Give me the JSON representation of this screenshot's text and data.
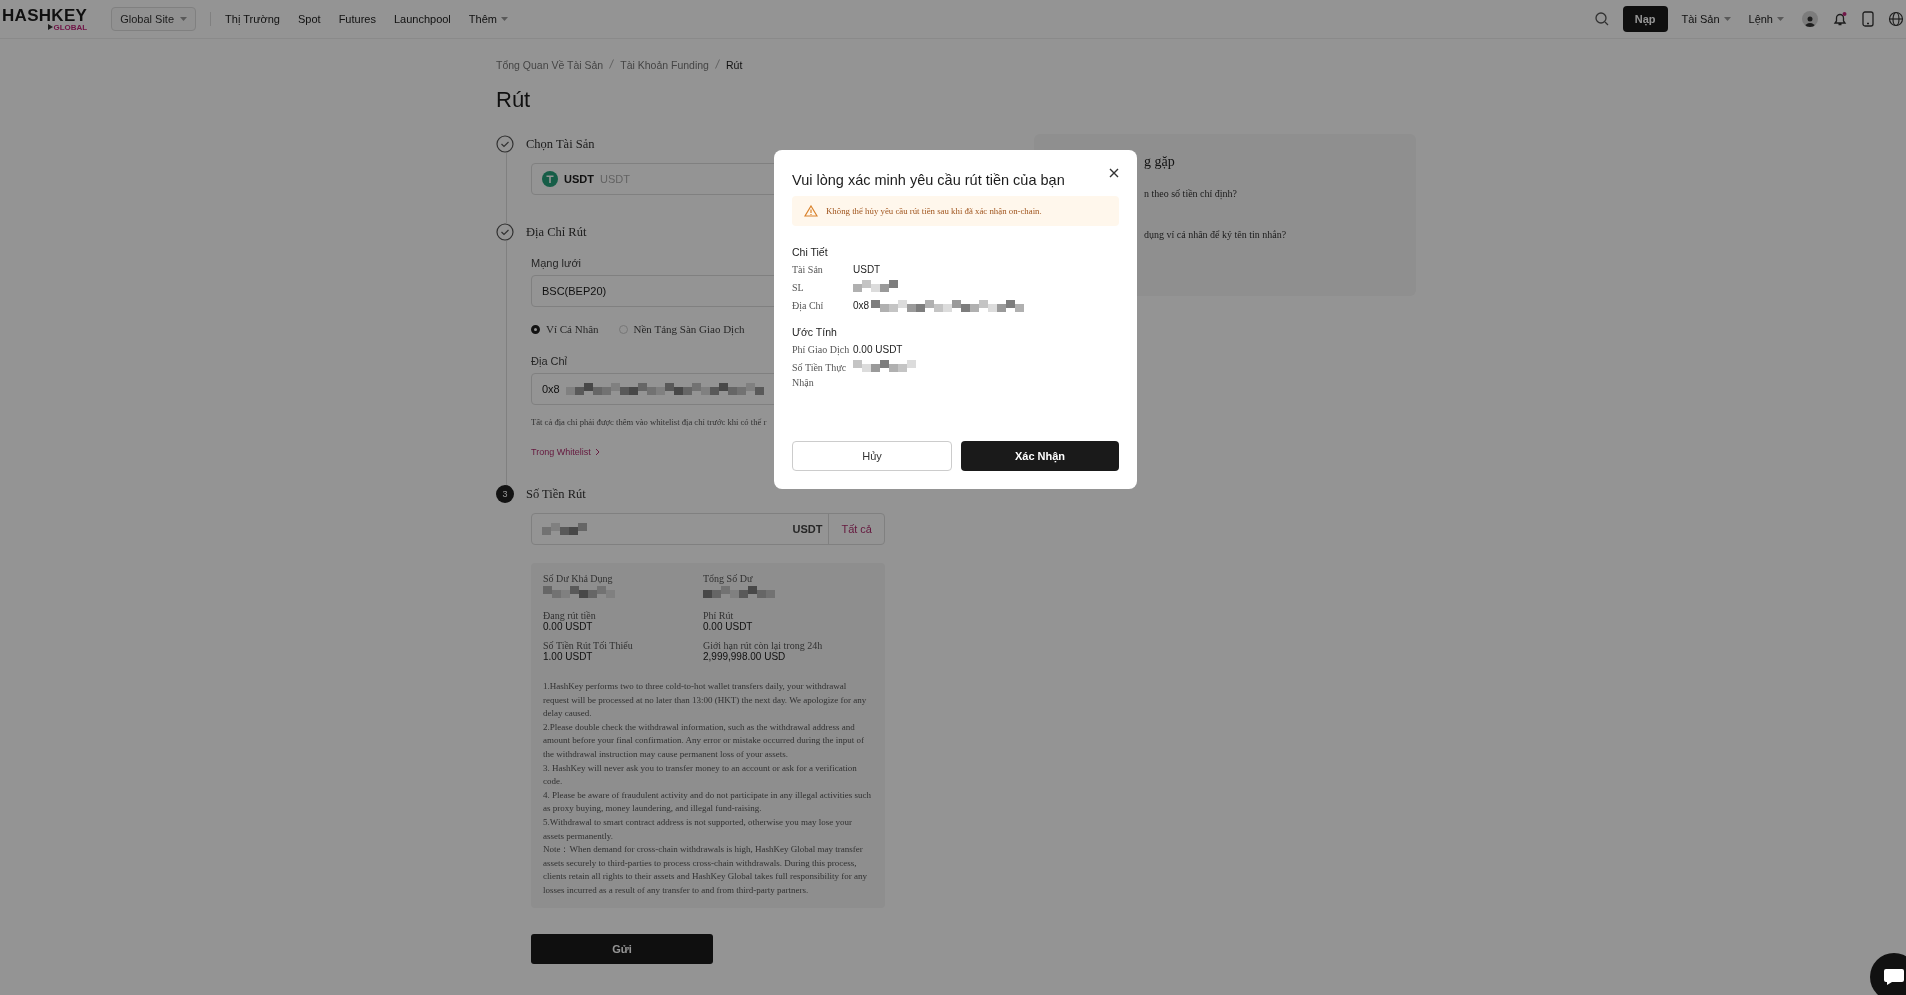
{
  "nav": {
    "logo": "HASHKEY",
    "logo_sub": "GLOBAL",
    "site_select": "Global Site",
    "menu": [
      {
        "label": "Thị Trường",
        "dropdown": false
      },
      {
        "label": "Spot",
        "dropdown": false
      },
      {
        "label": "Futures",
        "dropdown": false
      },
      {
        "label": "Launchpool",
        "dropdown": false
      },
      {
        "label": "Thêm",
        "dropdown": true
      }
    ],
    "deposit_button": "Nạp",
    "right_menu": [
      "Tài Sản",
      "Lệnh"
    ],
    "notifications_unread": true
  },
  "breadcrumb": [
    "Tổng Quan Về Tài Sản",
    "Tài Khoản Funding",
    "Rút"
  ],
  "title": "Rút",
  "asset_step": {
    "label": "Chọn Tài Sản",
    "done": true,
    "asset_symbol": "USDT",
    "asset_name": "USDT"
  },
  "address_step": {
    "label": "Địa Chỉ Rút",
    "done": true,
    "network_label": "Mạng lưới",
    "network": "BSC(BEP20)",
    "wallet_types": [
      {
        "label": "Ví Cá Nhân",
        "selected": true
      },
      {
        "label": "Nền Tảng Sàn Giao Dịch",
        "selected": false
      }
    ],
    "address_label": "Địa Chỉ",
    "address_prefix": "0x8",
    "hint": "Tất cả địa chỉ phải được thêm vào whitelist địa chỉ trước khi có thể r",
    "whitelist_link": "Trong Whitelist"
  },
  "amount_step": {
    "number": "3",
    "label": "Số Tiền Rút",
    "done": false,
    "unit": "USDT",
    "all_button": "Tất cả",
    "stats": [
      {
        "label": "Số Dư Khả Dụng",
        "masked": true
      },
      {
        "label": "Tổng Số Dư",
        "masked": true
      },
      {
        "label": "Đang rút tiền",
        "value": "0.00 USDT",
        "masked": false
      },
      {
        "label": "Phí Rút",
        "value": "0.00 USDT",
        "masked": false
      },
      {
        "label": "Số Tiền Rút Tối Thiểu",
        "value": "1.00 USDT",
        "masked": false
      },
      {
        "label": "Giới hạn rút còn lại trong 24h",
        "value": "2,999,998.00 USD",
        "masked": false
      }
    ],
    "notes": [
      "1.HashKey performs two to three cold-to-hot wallet transfers daily, your withdrawal request will be processed at no later than 13:00 (HKT) the next day. We apologize for any delay caused.",
      "2.Please double check the withdrawal information, such as the withdrawal address and amount before your final confirmation. Any error or mistake occurred during the input of the withdrawal instruction may cause permanent loss of your assets.",
      "3. HashKey will never ask you to transfer money to an account or ask for a verification code.",
      "4. Please be aware of fraudulent activity and do not participate in any illegal activities such as proxy buying, money laundering, and illegal fund-raising.",
      "5.Withdrawal to smart contract address is not supported, otherwise you may lose your assets permanently.",
      "Note：When demand for cross-chain withdrawals is high, HashKey Global may transfer assets securely to third-parties to process cross-chain withdrawals. During this process, clients retain all rights to their assets and HashKey Global takes full responsibility for any losses incurred as a result of any transfer to and from third-party partners."
    ]
  },
  "submit_button": "Gửi",
  "faq": {
    "title_fragment": "g gặp",
    "questions": [
      "n theo số tiền chỉ định?",
      "dụng ví cá nhân để ký tên tin nhắn?"
    ]
  },
  "modal": {
    "title": "Vui lòng xác minh yêu cầu rút tiền của bạn",
    "warning": "Không thể hủy yêu cầu rút tiền sau khi đã xác nhận on-chain.",
    "details_heading": "Chi Tiết",
    "details": [
      {
        "label": "Tài Sản",
        "value": "USDT",
        "masked": false
      },
      {
        "label": "SL",
        "masked": true
      },
      {
        "label": "Địa Chỉ",
        "value": "0x8",
        "masked": true
      }
    ],
    "estimate_heading": "Ước Tính",
    "estimates": [
      {
        "label": "Phí Giao Dịch",
        "value": "0.00 USDT",
        "masked": false
      },
      {
        "label": "Số Tiền Thực Nhận",
        "masked": true
      }
    ],
    "cancel_button": "Hủy",
    "confirm_button": "Xác Nhận"
  }
}
